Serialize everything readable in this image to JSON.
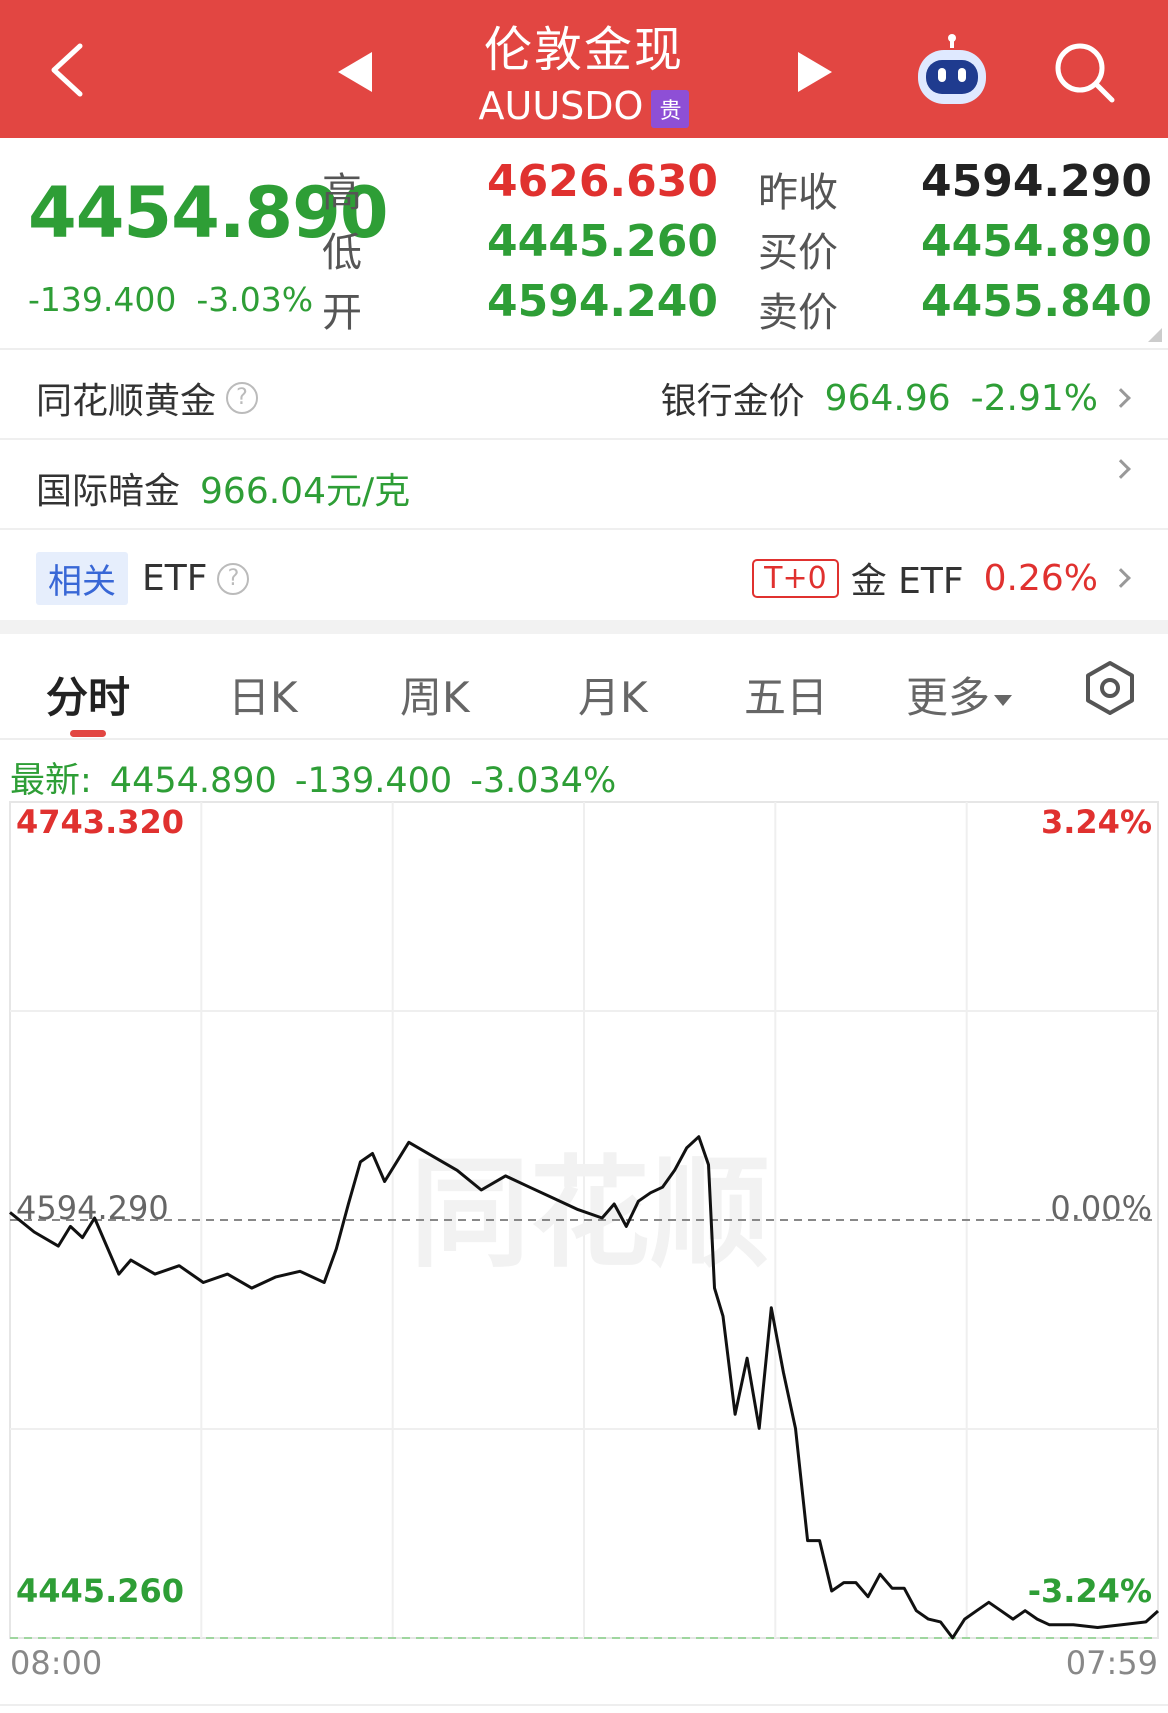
{
  "header": {
    "title": "伦敦金现",
    "subtitle": "AUUSDO",
    "badge": "贵"
  },
  "quote": {
    "price": "4454.890",
    "change": "-139.400",
    "change_pct": "-3.03%",
    "high_label": "高",
    "low_label": "低",
    "open_label": "开",
    "high": "4626.630",
    "low": "4445.260",
    "open": "4594.240",
    "prev_close_label": "昨收",
    "bid_label": "买价",
    "ask_label": "卖价",
    "prev_close": "4594.290",
    "bid": "4454.890",
    "ask": "4455.840"
  },
  "rows": {
    "ths_gold_label": "同花顺黄金",
    "bank_gold_label": "银行金价",
    "bank_gold_price": "964.96",
    "bank_gold_pct": "-2.91%",
    "intl_label": "国际暗金",
    "intl_value": "966.04元/克",
    "related_tag": "相关",
    "etf_label": "ETF",
    "t0_tag": "T+0",
    "gold_etf_label": "金 ETF",
    "gold_etf_pct": "0.26%"
  },
  "tabs": [
    "分时",
    "日K",
    "周K",
    "月K",
    "五日",
    "更多"
  ],
  "latest": {
    "label": "最新:",
    "price": "4454.890",
    "change": "-139.400",
    "pct": "-3.034%"
  },
  "chart_labels": {
    "top_price": "4743.320",
    "top_pct": "3.24%",
    "mid_price": "4594.290",
    "mid_pct": "0.00%",
    "bottom_price": "4445.260",
    "bottom_pct": "-3.24%",
    "start_time": "08:00",
    "end_time": "07:59",
    "watermark": "同花顺"
  },
  "colors": {
    "up": "#e0312f",
    "down": "#2e9e36",
    "header": "#e24642"
  },
  "chart_data": {
    "type": "line",
    "x_range": [
      "08:00",
      "07:59"
    ],
    "ylim": [
      4445.26,
      4743.32
    ],
    "baseline": 4594.29,
    "points": [
      [
        0,
        4597
      ],
      [
        2,
        4590
      ],
      [
        4,
        4585
      ],
      [
        5,
        4592
      ],
      [
        6,
        4588
      ],
      [
        7,
        4595
      ],
      [
        8,
        4585
      ],
      [
        9,
        4575
      ],
      [
        10,
        4580
      ],
      [
        12,
        4575
      ],
      [
        14,
        4578
      ],
      [
        16,
        4572
      ],
      [
        18,
        4575
      ],
      [
        20,
        4570
      ],
      [
        22,
        4574
      ],
      [
        24,
        4576
      ],
      [
        26,
        4572
      ],
      [
        27,
        4584
      ],
      [
        28,
        4600
      ],
      [
        29,
        4615
      ],
      [
        30,
        4618
      ],
      [
        31,
        4608
      ],
      [
        32,
        4615
      ],
      [
        33,
        4622
      ],
      [
        35,
        4617
      ],
      [
        37,
        4612
      ],
      [
        39,
        4605
      ],
      [
        41,
        4610
      ],
      [
        43,
        4606
      ],
      [
        45,
        4602
      ],
      [
        47,
        4598
      ],
      [
        49,
        4595
      ],
      [
        50,
        4600
      ],
      [
        51,
        4592
      ],
      [
        52,
        4601
      ],
      [
        53,
        4604
      ],
      [
        54,
        4606
      ],
      [
        55,
        4612
      ],
      [
        56,
        4620
      ],
      [
        57,
        4624
      ],
      [
        57.8,
        4614
      ],
      [
        58.3,
        4570
      ],
      [
        59,
        4560
      ],
      [
        60,
        4525
      ],
      [
        61,
        4545
      ],
      [
        62,
        4520
      ],
      [
        63,
        4563
      ],
      [
        64,
        4540
      ],
      [
        65,
        4520
      ],
      [
        66,
        4480
      ],
      [
        67,
        4480
      ],
      [
        68,
        4462
      ],
      [
        69,
        4465
      ],
      [
        70,
        4465
      ],
      [
        71,
        4460
      ],
      [
        72,
        4468
      ],
      [
        73,
        4463
      ],
      [
        74,
        4463
      ],
      [
        75,
        4455
      ],
      [
        76,
        4452
      ],
      [
        77,
        4451
      ],
      [
        78,
        4445.3
      ],
      [
        79,
        4452
      ],
      [
        80,
        4455
      ],
      [
        81,
        4458
      ],
      [
        82,
        4455
      ],
      [
        83,
        4452
      ],
      [
        84,
        4455
      ],
      [
        85,
        4452
      ],
      [
        86,
        4450
      ],
      [
        88,
        4450
      ],
      [
        90,
        4449
      ],
      [
        92,
        4450
      ],
      [
        94,
        4451
      ],
      [
        95,
        4454.89
      ]
    ],
    "x_unit": "index of session (0=08:00, 95=07:59)"
  }
}
